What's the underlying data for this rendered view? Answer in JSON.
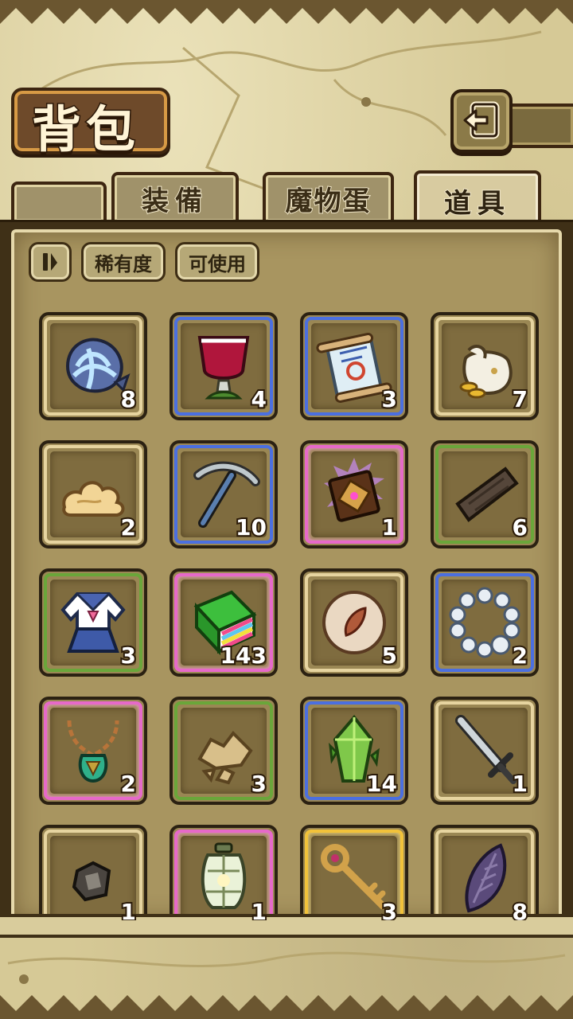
{
  "screen": {
    "title": "背包",
    "back_icon": "back-arrow-icon"
  },
  "tabs": [
    {
      "label": "装備",
      "active": false
    },
    {
      "label": "魔物蛋",
      "active": false
    },
    {
      "label": "道具",
      "active": true
    }
  ],
  "filters": {
    "sort_icon": "sort-toggle-icon",
    "rarity_label": "稀有度",
    "usable_label": "可使用"
  },
  "rarity_colors": {
    "common": "#e6d4a0",
    "green": "#6aa63a",
    "blue": "#4b6fe0",
    "pink": "#e669c9",
    "gold": "#f2c23a"
  },
  "items": [
    {
      "icon": "shell-icon",
      "rarity": "common",
      "qty": "8"
    },
    {
      "icon": "goblet-icon",
      "rarity": "blue",
      "qty": "4"
    },
    {
      "icon": "scroll-icon",
      "rarity": "blue",
      "qty": "3"
    },
    {
      "icon": "coin-bag-icon",
      "rarity": "common",
      "qty": "7"
    },
    {
      "icon": "cloud-icon",
      "rarity": "common",
      "qty": "2"
    },
    {
      "icon": "pickaxe-icon",
      "rarity": "blue",
      "qty": "10"
    },
    {
      "icon": "magic-book-icon",
      "rarity": "pink",
      "qty": "1"
    },
    {
      "icon": "wood-plank-icon",
      "rarity": "green",
      "qty": "6"
    },
    {
      "icon": "sailor-uniform-icon",
      "rarity": "green",
      "qty": "3"
    },
    {
      "icon": "rainbow-book-icon",
      "rarity": "pink",
      "qty": "143"
    },
    {
      "icon": "leaf-orb-icon",
      "rarity": "common",
      "qty": "5"
    },
    {
      "icon": "pearl-necklace-icon",
      "rarity": "blue",
      "qty": "2"
    },
    {
      "icon": "amulet-icon",
      "rarity": "pink",
      "qty": "2"
    },
    {
      "icon": "ore-rocks-icon",
      "rarity": "green",
      "qty": "3"
    },
    {
      "icon": "green-crystal-icon",
      "rarity": "blue",
      "qty": "14"
    },
    {
      "icon": "sword-icon",
      "rarity": "common",
      "qty": "1"
    },
    {
      "icon": "dark-ore-icon",
      "rarity": "common",
      "qty": "1"
    },
    {
      "icon": "lantern-icon",
      "rarity": "pink",
      "qty": "1"
    },
    {
      "icon": "golden-key-icon",
      "rarity": "gold",
      "qty": "3"
    },
    {
      "icon": "purple-feather-icon",
      "rarity": "common",
      "qty": "8"
    }
  ]
}
